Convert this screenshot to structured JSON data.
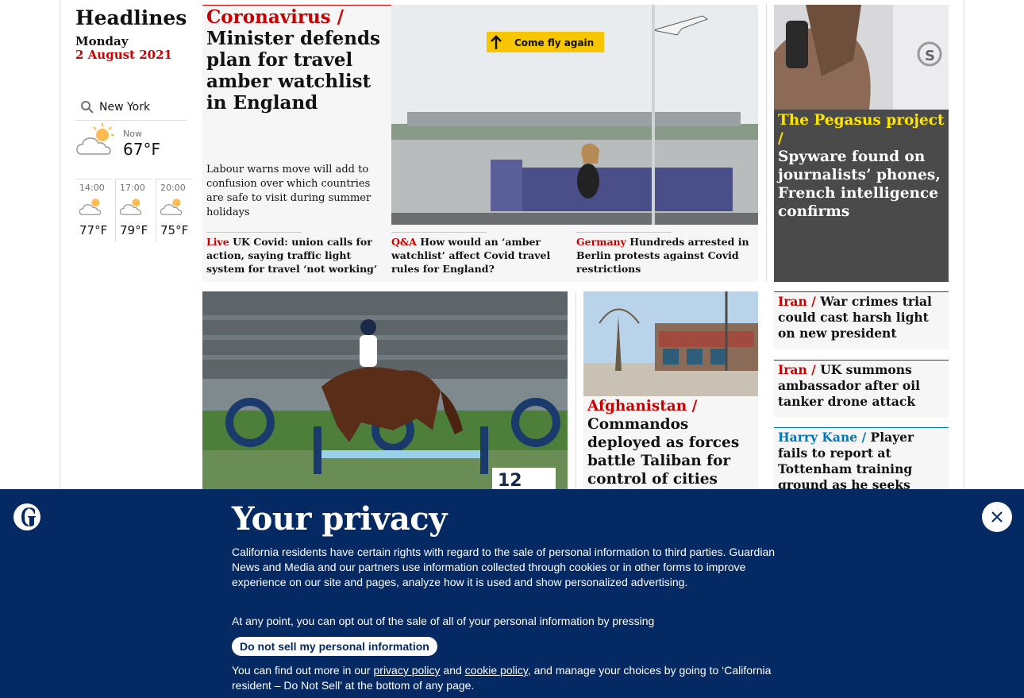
{
  "sidebar": {
    "heading": "Headlines",
    "day": "Monday",
    "date": "2 August 2021"
  },
  "weather": {
    "location": "New York",
    "now_label": "Now",
    "now_temp": "67°F",
    "forecast": [
      {
        "time": "14:00",
        "temp": "77°F"
      },
      {
        "time": "17:00",
        "temp": "79°F"
      },
      {
        "time": "20:00",
        "temp": "75°F"
      }
    ]
  },
  "top_story": {
    "kicker": "Coronavirus /",
    "headline": "Minister defends plan for travel amber watchlist in England",
    "standfirst": "Labour warns move will add to confusion over which countries are safe to visit during summer holidays",
    "image_sign": "Come fly again",
    "sublinks": [
      {
        "kicker": "Live",
        "text": "UK Covid: union calls for action, saying traffic light system for travel ‘not working’"
      },
      {
        "kicker": "Q&A",
        "text": "How would an ‘amber watchlist’ affect Covid travel rules for England?"
      },
      {
        "kicker": "Germany",
        "text": "Hundreds arrested in Berlin protests against Covid restrictions"
      }
    ]
  },
  "pegasus": {
    "kicker": "The Pegasus project /",
    "headline": "Spyware found on journalists’ phones, French intelligence confirms"
  },
  "afghanistan": {
    "kicker": "Afghanistan /",
    "headline": "Commandos deployed as forces battle Taliban for control of cities"
  },
  "right_list": [
    {
      "kicker": "Iran /",
      "text": "War crimes trial could cast harsh light on new president"
    },
    {
      "kicker": "Iran /",
      "text": "UK summons ambassador after oil tanker drone attack"
    },
    {
      "kicker": "Harry Kane /",
      "text": "Player fails to report at Tottenham training ground as he seeks transfer"
    }
  ],
  "horse_image": {
    "sign": "12"
  },
  "privacy": {
    "title": "Your privacy",
    "body": "California residents have certain rights with regard to the sale of personal information to third parties. Guardian News and Media and our partners use information collected through cookies or in other forms to improve experience on our site and pages, analyze how it is used and show personalized advertising.",
    "body2": "At any point, you can opt out of the sale of all of your personal information by pressing",
    "button": "Do not sell my personal information",
    "body3_pre": "You can find out more in our ",
    "privacy_link": "privacy policy",
    "and": " and ",
    "cookie_link": "cookie policy",
    "body3_post": ", and manage your choices by going to ‘California resident – Do Not Sell’ at the bottom of any page."
  },
  "colors": {
    "news_red": "#c70000",
    "pegasus_yellow": "#ffe500",
    "sport_blue": "#0077b6",
    "privacy_bg": "#052962"
  }
}
